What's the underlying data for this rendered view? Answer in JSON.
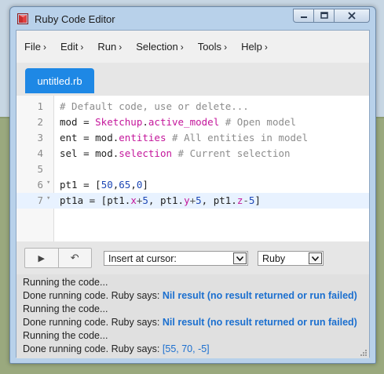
{
  "window": {
    "title": "Ruby Code Editor",
    "icon": "sketchup-ruby-icon",
    "controls": [
      "minimize-icon",
      "maximize-icon",
      "close-icon"
    ]
  },
  "menu": [
    {
      "label": "File",
      "chevron": "›"
    },
    {
      "label": "Edit",
      "chevron": "›"
    },
    {
      "label": "Run",
      "chevron": "›"
    },
    {
      "label": "Selection",
      "chevron": "›"
    },
    {
      "label": "Tools",
      "chevron": "›"
    },
    {
      "label": "Help",
      "chevron": "›"
    }
  ],
  "tabs": [
    {
      "label": "untitled.rb",
      "active": true,
      "color": "#1e88e5"
    }
  ],
  "editor": {
    "lines": [
      {
        "num": "1",
        "fold": ""
      },
      {
        "num": "2",
        "fold": ""
      },
      {
        "num": "3",
        "fold": ""
      },
      {
        "num": "4",
        "fold": ""
      },
      {
        "num": "5",
        "fold": ""
      },
      {
        "num": "6",
        "fold": "▾"
      },
      {
        "num": "7",
        "fold": "▾"
      }
    ],
    "line1": {
      "comment": "# Default code, use or delete..."
    },
    "line2": {
      "a": "mod = ",
      "b": "Sketchup",
      "c": ".",
      "d": "active_model",
      "e": " ",
      "f": "# Open model"
    },
    "line3": {
      "a": "ent = mod.",
      "b": "entities",
      "c": " ",
      "d": "# All entities in model"
    },
    "line4": {
      "a": "sel = mod.",
      "b": "selection",
      "c": " ",
      "d": "# Current selection"
    },
    "line6": {
      "a": "pt1 = [",
      "n1": "50",
      "s1": ",",
      "n2": "65",
      "s2": ",",
      "n3": "0",
      "e": "]"
    },
    "line7": {
      "a": "pt1a = [pt1.",
      "x": "x",
      "p1": "+",
      "n1": "5",
      "m1": ", pt1.",
      "y": "y",
      "p2": "+",
      "n2": "5",
      "m2": ", pt1.",
      "z": "z",
      "p3": "-",
      "n3": "5",
      "e": "]"
    },
    "active_line": "7",
    "colors": {
      "comment": "#8c8c8c",
      "keyword": "#c4169b",
      "number": "#1d47b5"
    }
  },
  "toolbar": {
    "run_icon": "play-icon",
    "undo_icon": "undo-icon",
    "run_glyph": "▶",
    "undo_glyph": "↶",
    "insert_select": "Insert at cursor:",
    "lang_select": "Ruby"
  },
  "console": {
    "lines": [
      {
        "text": "Running the code...",
        "result": ""
      },
      {
        "text": "Done running code. Ruby says: ",
        "result": "Nil result (no result returned or run failed)"
      },
      {
        "text": "Running the code...",
        "result": ""
      },
      {
        "text": "Done running code. Ruby says: ",
        "result": "Nil result (no result returned or run failed)"
      },
      {
        "text": "Running the code...",
        "result": ""
      },
      {
        "text": "Done running code. Ruby says: ",
        "result": "[55, 70, -5]"
      }
    ],
    "result_color": "#1b6fcf"
  }
}
